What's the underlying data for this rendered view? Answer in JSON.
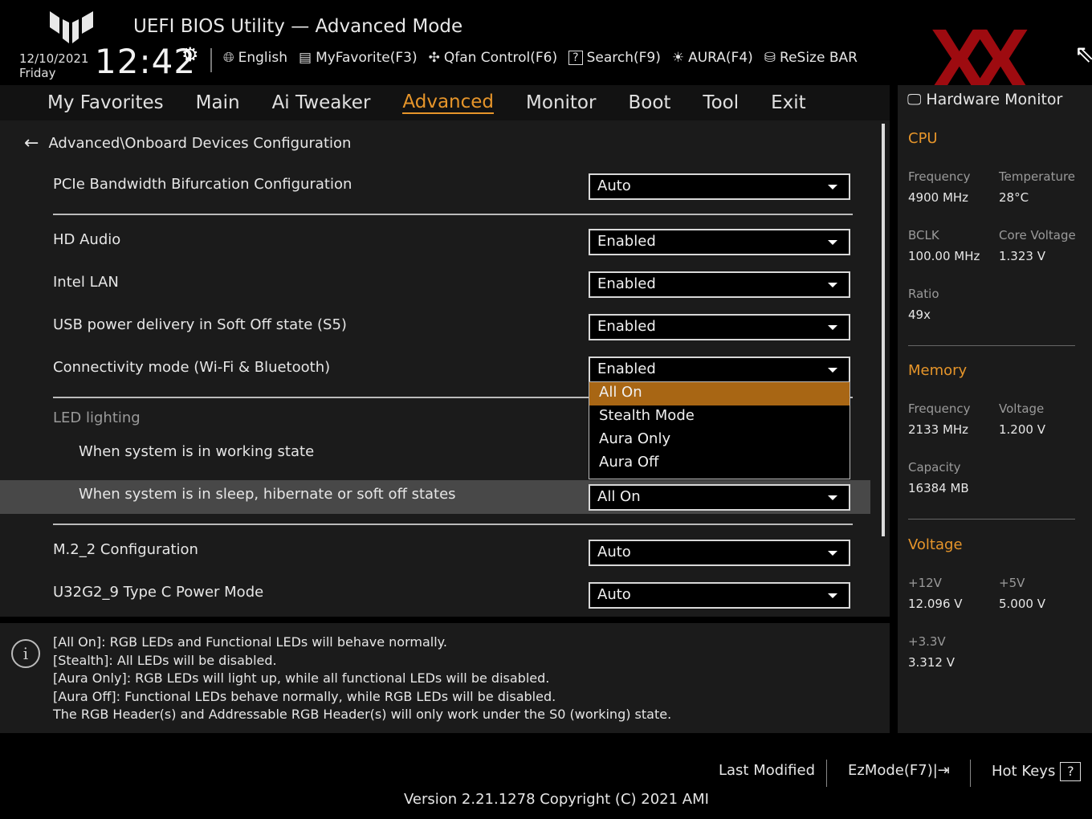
{
  "header": {
    "title": "UEFI BIOS Utility — Advanced Mode",
    "date": "12/10/2021",
    "day": "Friday",
    "time": "12:42",
    "toolbar": {
      "language": "English",
      "myfavorite": "MyFavorite(F3)",
      "qfan": "Qfan Control(F6)",
      "search": "Search(F9)",
      "aura": "AURA(F4)",
      "resizebar": "ReSize BAR"
    }
  },
  "tabs": [
    "My Favorites",
    "Main",
    "Ai Tweaker",
    "Advanced",
    "Monitor",
    "Boot",
    "Tool",
    "Exit"
  ],
  "active_tab": "Advanced",
  "breadcrumb": "Advanced\\Onboard Devices Configuration",
  "settings": {
    "pcie": {
      "label": "PCIe Bandwidth Bifurcation Configuration",
      "value": "Auto"
    },
    "hd_audio": {
      "label": "HD Audio",
      "value": "Enabled"
    },
    "intel_lan": {
      "label": "Intel LAN",
      "value": "Enabled"
    },
    "usb_power": {
      "label": "USB power delivery in Soft Off state (S5)",
      "value": "Enabled"
    },
    "connectivity": {
      "label": "Connectivity mode (Wi-Fi & Bluetooth)",
      "value": "Enabled"
    },
    "led_heading": "LED lighting",
    "led_working": {
      "label": "When system is in working state"
    },
    "led_sleep": {
      "label": "When system is in sleep, hibernate or soft off states",
      "value": "All On"
    },
    "m2_2": {
      "label": "M.2_2 Configuration",
      "value": "Auto"
    },
    "u32g2": {
      "label": "U32G2_9 Type C Power Mode",
      "value": "Auto"
    }
  },
  "dropdown_options": [
    "All On",
    "Stealth Mode",
    "Aura Only",
    "Aura Off"
  ],
  "dropdown_selected": "All On",
  "help": {
    "lines": [
      "[All On]: RGB LEDs and Functional LEDs will behave normally.",
      "[Stealth]: All LEDs will be disabled.",
      "[Aura Only]: RGB LEDs will light up, while all functional LEDs will be disabled.",
      "[Aura Off]: Functional LEDs behave normally, while RGB LEDs will be disabled.",
      "The RGB Header(s) and Addressable RGB Header(s) will only work under the S0 (working) state."
    ]
  },
  "hardware_monitor": {
    "title": "Hardware Monitor",
    "cpu": {
      "heading": "CPU",
      "frequency_label": "Frequency",
      "frequency": "4900 MHz",
      "temperature_label": "Temperature",
      "temperature": "28°C",
      "bclk_label": "BCLK",
      "bclk": "100.00 MHz",
      "core_voltage_label": "Core Voltage",
      "core_voltage": "1.323 V",
      "ratio_label": "Ratio",
      "ratio": "49x"
    },
    "memory": {
      "heading": "Memory",
      "frequency_label": "Frequency",
      "frequency": "2133 MHz",
      "voltage_label": "Voltage",
      "voltage": "1.200 V",
      "capacity_label": "Capacity",
      "capacity": "16384 MB"
    },
    "voltage": {
      "heading": "Voltage",
      "v12_label": "+12V",
      "v12": "12.096 V",
      "v5_label": "+5V",
      "v5": "5.000 V",
      "v33_label": "+3.3V",
      "v33": "3.312 V"
    }
  },
  "footer": {
    "last_modified": "Last Modified",
    "ezmode": "EzMode(F7)|",
    "hotkeys": "Hot Keys",
    "hotkeys_icon": "?",
    "version": "Version 2.21.1278 Copyright (C) 2021 AMI"
  },
  "colors": {
    "accent": "#e6952a",
    "selected_option": "#a86614",
    "highlight_row": "#484848",
    "watermark": "#b00d12"
  },
  "watermark": "XX"
}
